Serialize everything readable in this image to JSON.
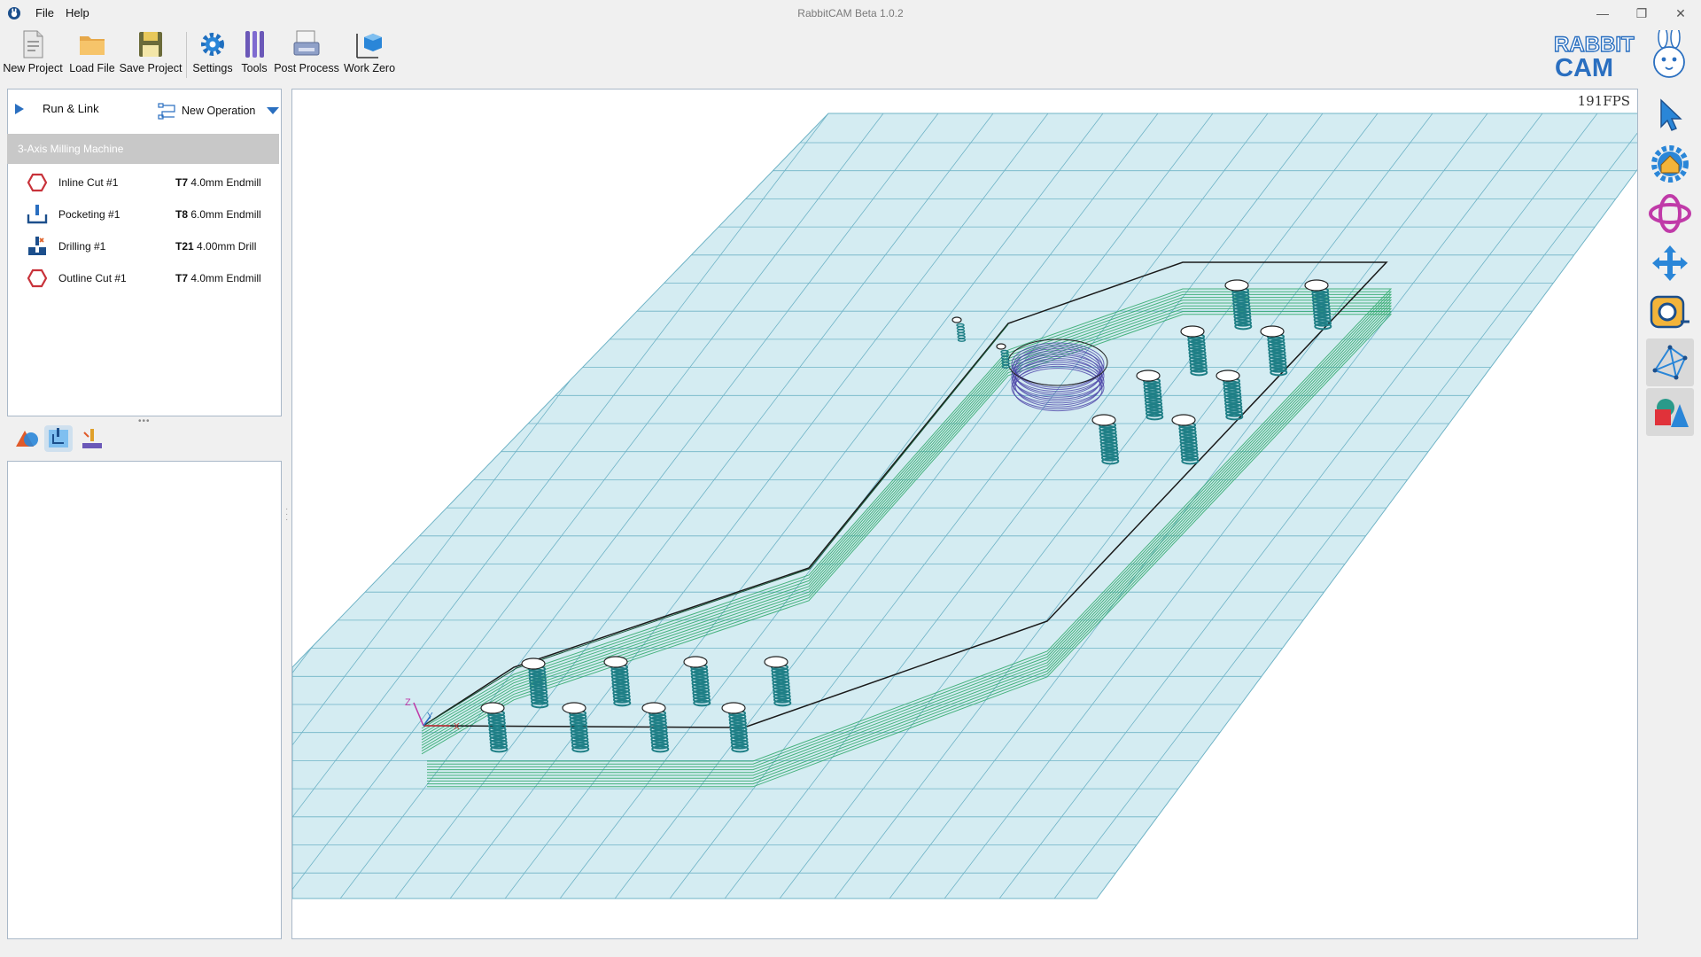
{
  "window": {
    "title": "RabbitCAM Beta 1.0.2",
    "menu": [
      "File",
      "Help"
    ],
    "controls": [
      "—",
      "❐",
      "✕"
    ]
  },
  "toolbar": {
    "buttons": [
      "New Project",
      "Load File",
      "Save Project",
      "Settings",
      "Tools",
      "Post Process",
      "Work Zero"
    ]
  },
  "logo": {
    "line1": "RABBIT",
    "line2": "CAM"
  },
  "operations_panel": {
    "run_link": "Run & Link",
    "new_operation": "New Operation",
    "machine": "3-Axis Milling Machine",
    "operations": [
      {
        "name": "Inline Cut #1",
        "tool_id": "T7",
        "tool_desc": "4.0mm Endmill",
        "icon": "hexagon-outline-icon"
      },
      {
        "name": "Pocketing #1",
        "tool_id": "T8",
        "tool_desc": "6.0mm Endmill",
        "icon": "pocket-icon"
      },
      {
        "name": "Drilling #1",
        "tool_id": "T21",
        "tool_desc": "4.00mm Drill",
        "icon": "drill-icon"
      },
      {
        "name": "Outline Cut #1",
        "tool_id": "T7",
        "tool_desc": "4.0mm Endmill",
        "icon": "hexagon-outline-icon"
      }
    ]
  },
  "viewport": {
    "fps": "191FPS",
    "axes": {
      "z": "Z",
      "y": "Y",
      "x": "X"
    }
  },
  "right_tools": [
    "select-arrow-icon",
    "home-view-icon",
    "orbit-icon",
    "pan-icon",
    "measure-icon",
    "wireframe-icon",
    "solid-shapes-icon"
  ],
  "colors": {
    "grid_fill": "#d4ecf2",
    "grid_line": "#6fb3c6",
    "toolpath": "#2ea86a",
    "drill": "#1f7f86",
    "pocket": "#4b44a8"
  }
}
